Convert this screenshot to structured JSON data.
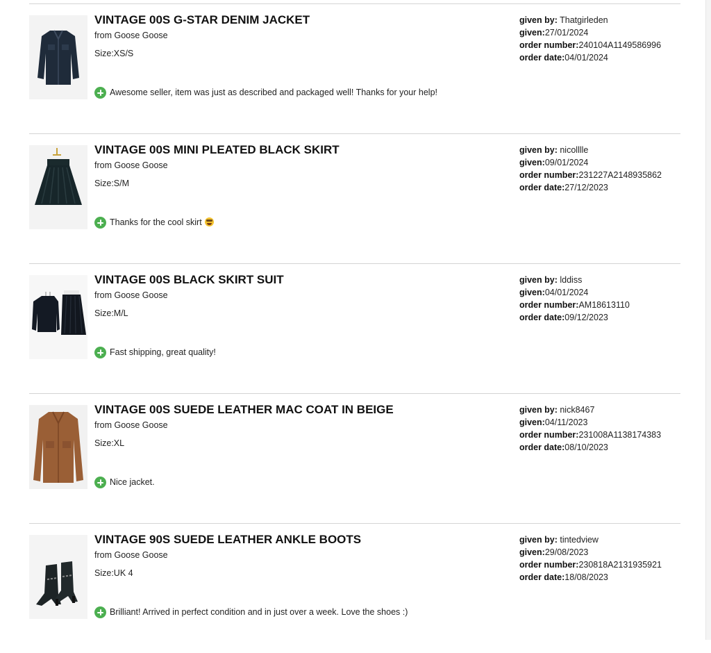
{
  "labels": {
    "given_by": "given by:",
    "given": "given:",
    "order_number": "order number:",
    "order_date": "order date:"
  },
  "colors": {
    "positive_icon": "#4caf50",
    "divider": "#d4d4d4"
  },
  "feedback": [
    {
      "title": "VINTAGE 00S G-STAR DENIM JACKET",
      "seller": "from Goose Goose",
      "size": "Size:XS/S",
      "comment": "Awesome seller, item was just as described and packaged well! Thanks for your help!",
      "given_by": "Thatgirleden",
      "given": "27/01/2024",
      "order_number": "240104A1149586996",
      "order_date": "04/01/2024",
      "thumb_icon": "denim-jacket-icon"
    },
    {
      "title": "VINTAGE 00S MINI PLEATED BLACK SKIRT",
      "seller": "from Goose Goose",
      "size": "Size:S/M",
      "comment": "Thanks for the cool skirt",
      "comment_emoji": "star-struck-emoji-icon",
      "given_by": "nicolllle",
      "given": "09/01/2024",
      "order_number": "231227A2148935862",
      "order_date": "27/12/2023",
      "thumb_icon": "pleated-skirt-icon"
    },
    {
      "title": "VINTAGE 00S BLACK SKIRT SUIT",
      "seller": "from Goose Goose",
      "size": "Size:M/L",
      "comment": "Fast shipping, great quality!",
      "given_by": "lddiss",
      "given": "04/01/2024",
      "order_number": "AM18613110",
      "order_date": "09/12/2023",
      "thumb_icon": "skirt-suit-icon"
    },
    {
      "title": "VINTAGE 00S SUEDE LEATHER MAC COAT IN BEIGE",
      "seller": "from Goose Goose",
      "size": "Size:XL",
      "comment": "Nice jacket.",
      "given_by": "nick8467",
      "given": "04/11/2023",
      "order_number": "231008A1138174383",
      "order_date": "08/10/2023",
      "thumb_icon": "suede-coat-icon"
    },
    {
      "title": "VINTAGE 90S SUEDE LEATHER ANKLE BOOTS",
      "seller": "from Goose Goose",
      "size": "Size:UK 4",
      "comment": "Brilliant! Arrived in perfect condition and in just over a week. Love the shoes :)",
      "given_by": "tintedview",
      "given": "29/08/2023",
      "order_number": "230818A2131935921",
      "order_date": "18/08/2023",
      "thumb_icon": "ankle-boots-icon"
    }
  ]
}
